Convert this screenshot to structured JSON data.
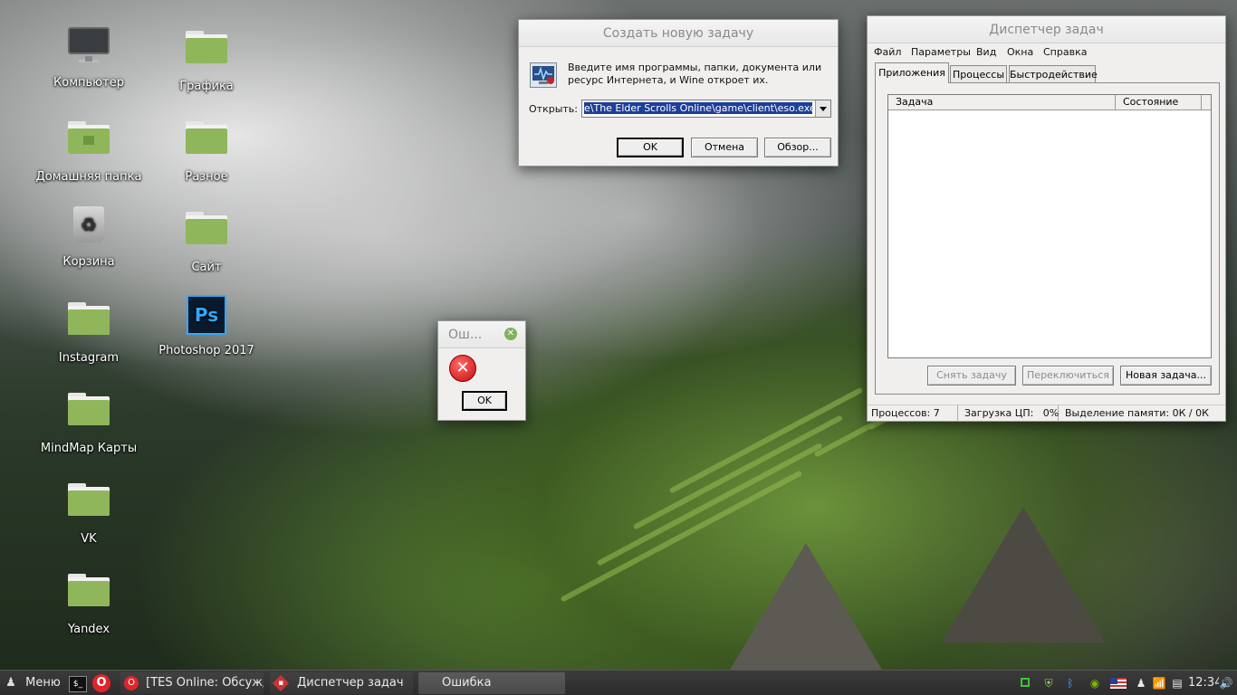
{
  "desktop": {
    "icons": [
      {
        "label": "Компьютер"
      },
      {
        "label": "Домашняя папка"
      },
      {
        "label": "Корзина"
      },
      {
        "label": "Instagram"
      },
      {
        "label": "MindMap Карты"
      },
      {
        "label": "VK"
      },
      {
        "label": "Yandex"
      },
      {
        "label": "Графика"
      },
      {
        "label": "Разное"
      },
      {
        "label": "Сайт"
      },
      {
        "label": "Photoshop 2017",
        "badge": "Ps"
      }
    ]
  },
  "run_dialog": {
    "title": "Создать новую задачу",
    "description": "Введите имя программы, папки, документа или ресурс Интернета, и Wine откроет их.",
    "open_label": "Открыть:",
    "input_value": "e\\The Elder Scrolls Online\\game\\client\\eso.exe",
    "ok_label": "OK",
    "cancel_label": "Отмена",
    "browse_label": "Обзор..."
  },
  "error_dialog": {
    "title": "Ош...",
    "ok_label": "OK"
  },
  "task_manager": {
    "title": "Диспетчер задач",
    "menu": [
      "Файл",
      "Параметры",
      "Вид",
      "Окна",
      "Справка"
    ],
    "tabs": [
      "Приложения",
      "Процессы",
      "Быстродействие"
    ],
    "columns": [
      "Задача",
      "Состояние"
    ],
    "end_task_label": "Снять задачу",
    "switch_label": "Переключиться",
    "new_task_label": "Новая задача...",
    "status": {
      "processes": "Процессов: 7",
      "cpu": "Загрузка ЦП:   0%",
      "memory": "Выделение памяти: 0К / 0К"
    }
  },
  "taskbar": {
    "menu_label": "Меню",
    "tasks": [
      {
        "label": "[TES Online: Обсужд..."
      },
      {
        "label": "Диспетчер задач"
      },
      {
        "label": "Ошибка"
      }
    ],
    "clock": "12:34"
  }
}
